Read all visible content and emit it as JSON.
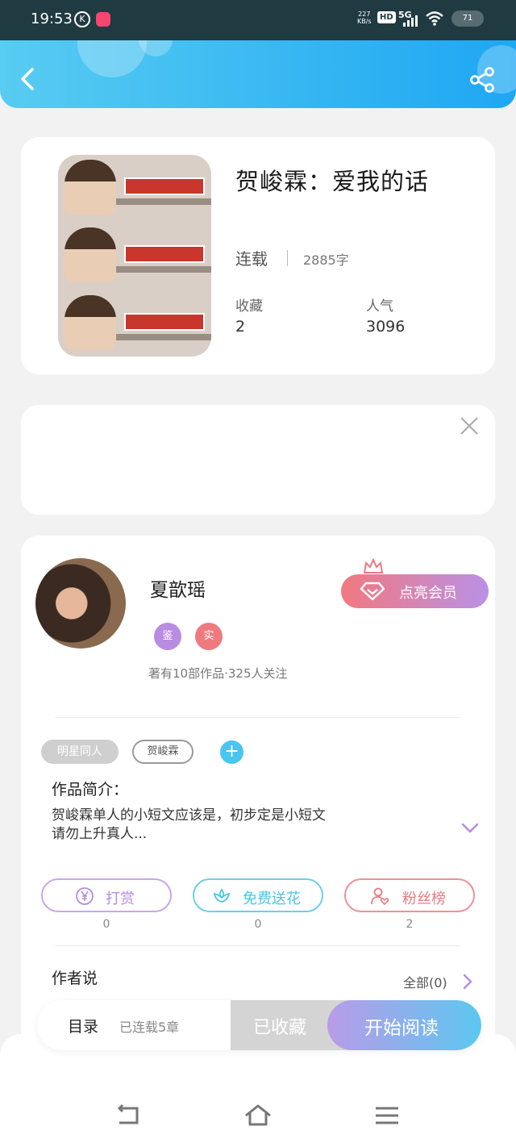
{
  "status_bar": {
    "time": "19:53",
    "left_icon": "K",
    "net_speed_value": "227",
    "net_speed_unit": "KB/s",
    "hd": "HD",
    "network": "5G",
    "battery": "71"
  },
  "header": {
    "back_icon": "chevron-left-icon",
    "share_icon": "share-icon",
    "accent": "#33b6f2"
  },
  "book": {
    "title": "贺峻霖：爱我的话",
    "status": "连载",
    "word_count": "2885字",
    "favorites_label": "收藏",
    "favorites_value": "2",
    "popularity_label": "人气",
    "popularity_value": "3096"
  },
  "author": {
    "name": "夏歆瑶",
    "badge_verify": "鉴",
    "badge_real": "实",
    "meta": "著有10部作品·325人关注",
    "vip_label": "点亮会员"
  },
  "tags": {
    "category": "明星同人",
    "character": "贺峻霖",
    "add": "+"
  },
  "intro": {
    "title": "作品简介：",
    "line1": "贺峻霖单人的小短文应该是，初步定是小短文",
    "line2": "请勿上升真人..."
  },
  "actions": [
    {
      "label": "打赏",
      "count": "0",
      "icon": "yen-icon",
      "color": "#b88ce0"
    },
    {
      "label": "免费送花",
      "count": "0",
      "icon": "flower-icon",
      "color": "#47c6e8"
    },
    {
      "label": "粉丝榜",
      "count": "2",
      "icon": "user-heart-icon",
      "color": "#ec7a7f"
    }
  ],
  "author_says": {
    "title": "作者说",
    "all_label": "全部(0)"
  },
  "read_bar": {
    "catalog": "目录",
    "chapters": "已连载5章",
    "collected": "已收藏",
    "start": "开始阅读"
  },
  "nav": {
    "back_icon": "nav-back-icon",
    "home_icon": "nav-home-icon",
    "menu_icon": "nav-menu-icon"
  }
}
